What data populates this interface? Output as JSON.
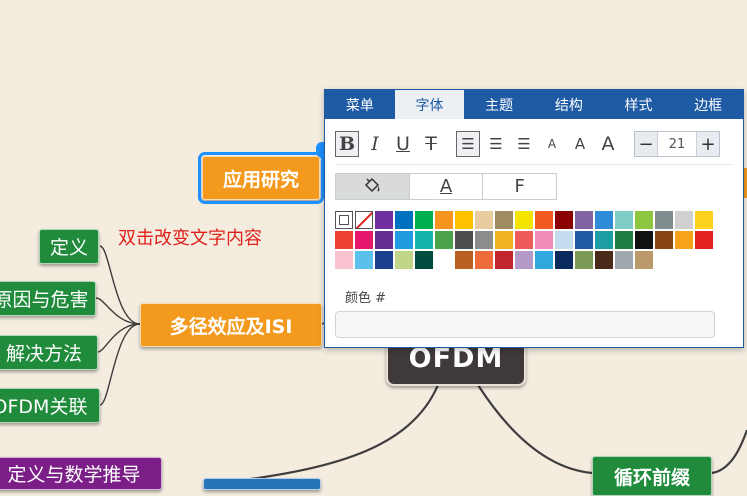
{
  "mindmap": {
    "central": "OFDM",
    "selected_node": "应用研究",
    "branch_main": "多径效应及ISI",
    "branch_cp": "循环前缀",
    "hint": "双击改变文字内容",
    "leaves": {
      "definition": "定义",
      "cause": "原因与危害",
      "solution": "解决方法",
      "relation": "OFDM关联",
      "math": "定义与数学推导"
    }
  },
  "panel": {
    "tabs": [
      {
        "label": "菜单"
      },
      {
        "label": "字体"
      },
      {
        "label": "主题"
      },
      {
        "label": "结构"
      },
      {
        "label": "样式"
      },
      {
        "label": "边框"
      }
    ],
    "active_tab": "字体",
    "format_buttons": {
      "bold": "B",
      "italic": "I",
      "underline": "U",
      "strike": "T",
      "align_left": "☰",
      "align_center": "☰",
      "align_right": "☰",
      "size_small": "A",
      "size_medium": "A",
      "size_large": "A"
    },
    "font_size": {
      "minus": "−",
      "value": "21",
      "plus": "+"
    },
    "modes": [
      {
        "label": "",
        "icon": "paint-bucket-icon"
      },
      {
        "label": "A"
      },
      {
        "label": "F"
      }
    ],
    "swatch_colors": [
      "#ffffff",
      "#ff0000",
      "#7030a0",
      "#0070c0",
      "#00b050",
      "#f7941d",
      "#ffc000",
      "#e6cc9f",
      "#a08b60",
      "#f4e500",
      "#f25a22",
      "#8b0000",
      "#8064a2",
      "#2e8bd8",
      "#7fcdc4",
      "#8dc63f",
      "#7f8c8d",
      "#d0d0d0",
      "#ffd21f",
      "#ef4136",
      "#e5176d",
      "#662d91",
      "#1f9be0",
      "#16b3ac",
      "#4aa34a",
      "#4d4d4d",
      "#8c8c8c",
      "#f0b323",
      "#f15a5a",
      "#f18cb8",
      "#c5dcef",
      "#1f5aa5",
      "#1a9da3",
      "#1e7d40",
      "#111111",
      "#8b4513",
      "#f7a21b",
      "#e52222",
      "#f9c3d1",
      "#5bc0eb",
      "#1c3f8f",
      "#c2d68a",
      "#004d40",
      "#ffffff",
      "#b8601d",
      "#ef6b3a",
      "#c0262c",
      "#b49ac8",
      "#2fa8df",
      "#0a2a5e",
      "#7b9955",
      "#4a2b1a",
      "#a0a8ae",
      "#b99a68"
    ],
    "color_label": "颜色 #",
    "color_value": ""
  }
}
